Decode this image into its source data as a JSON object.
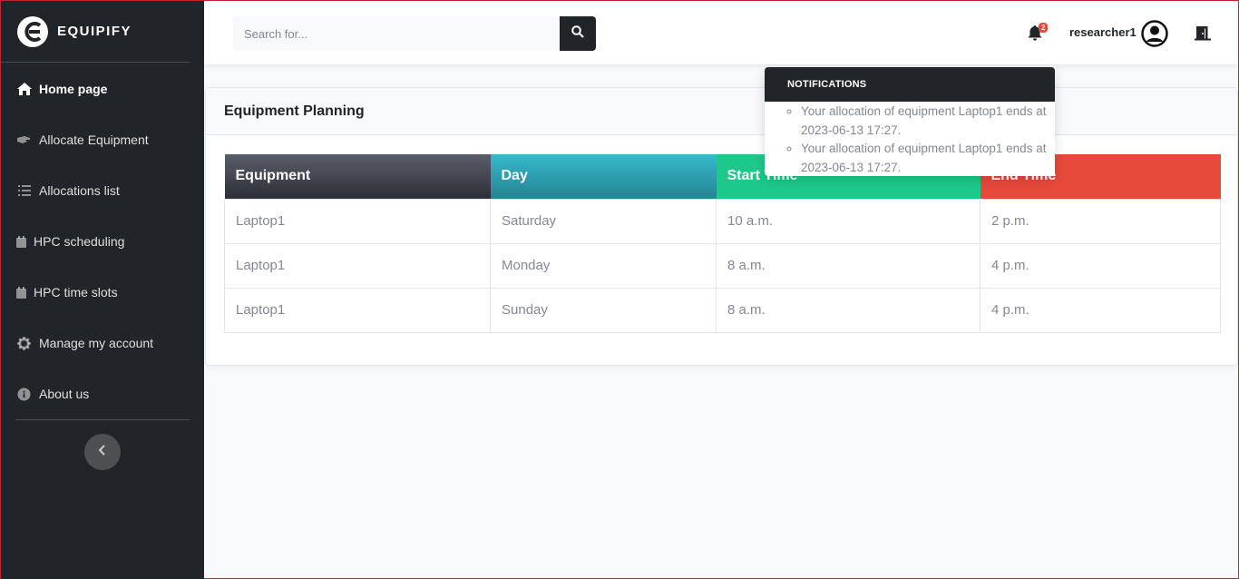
{
  "brand": {
    "name": "EQUIPIFY"
  },
  "sidebar": {
    "items": [
      {
        "label": "Home page",
        "icon": "home-icon"
      },
      {
        "label": "Allocate Equipment",
        "icon": "hand-icon"
      },
      {
        "label": "Allocations list",
        "icon": "list-icon"
      },
      {
        "label": "HPC scheduling",
        "icon": "calendar-icon"
      },
      {
        "label": "HPC time slots",
        "icon": "calendar-icon"
      },
      {
        "label": "Manage my account",
        "icon": "gear-icon"
      },
      {
        "label": "About us",
        "icon": "info-icon"
      }
    ]
  },
  "topbar": {
    "search_placeholder": "Search for...",
    "notification_count": "2",
    "username": "researcher1"
  },
  "notifications": {
    "title": "NOTIFICATIONS",
    "items": [
      "Your allocation of equipment Laptop1 ends at 2023-06-13 17:27.",
      "Your allocation of equipment Laptop1 ends at 2023-06-13 17:27."
    ]
  },
  "card": {
    "title": "Equipment Planning",
    "columns": [
      "Equipment",
      "Day",
      "Start Time",
      "End Time"
    ],
    "rows": [
      [
        "Laptop1",
        "Saturday",
        "10 a.m.",
        "2 p.m."
      ],
      [
        "Laptop1",
        "Monday",
        "8 a.m.",
        "4 p.m."
      ],
      [
        "Laptop1",
        "Sunday",
        "8 a.m.",
        "4 p.m."
      ]
    ]
  },
  "colors": {
    "sidebar_bg": "#212529",
    "equipment_header": "#3a3b45",
    "day_header": "#36b9cc",
    "start_header": "#1cc88a",
    "end_header": "#e74a3b"
  }
}
